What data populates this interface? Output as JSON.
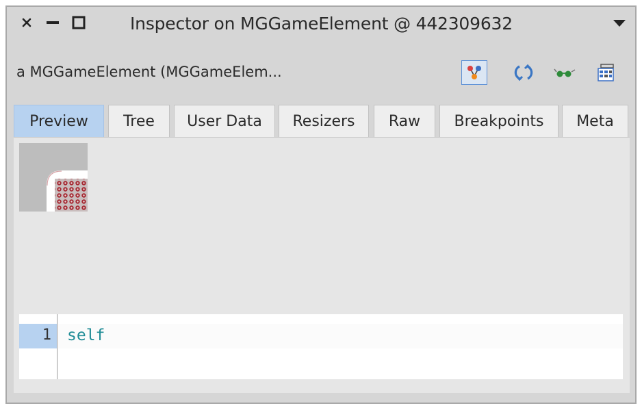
{
  "window": {
    "title": "Inspector on MGGameElement @ 442309632",
    "controls": [
      "close-icon",
      "minimize-icon",
      "maximize-icon",
      "window-menu-icon"
    ]
  },
  "header": {
    "object_title": "a MGGameElement (MGGameElem...",
    "actions": [
      "explore-icon",
      "refresh-icon",
      "glasses-icon",
      "browse-grid-icon"
    ]
  },
  "tabs": [
    {
      "label": "Preview",
      "active": true
    },
    {
      "label": "Tree",
      "active": false
    },
    {
      "label": "User Data",
      "active": false
    },
    {
      "label": "Resizers",
      "active": false
    },
    {
      "label": "Raw",
      "active": false
    },
    {
      "label": "Breakpoints",
      "active": false
    },
    {
      "label": "Meta",
      "active": false
    }
  ],
  "editor": {
    "line_number": "1",
    "code": "self"
  },
  "colors": {
    "accent": "#b7d2f0",
    "code_text": "#1f8c96",
    "window_bg": "#d6d6d6",
    "panel_bg": "#e6e6e6",
    "image_red": "#b0303a"
  }
}
